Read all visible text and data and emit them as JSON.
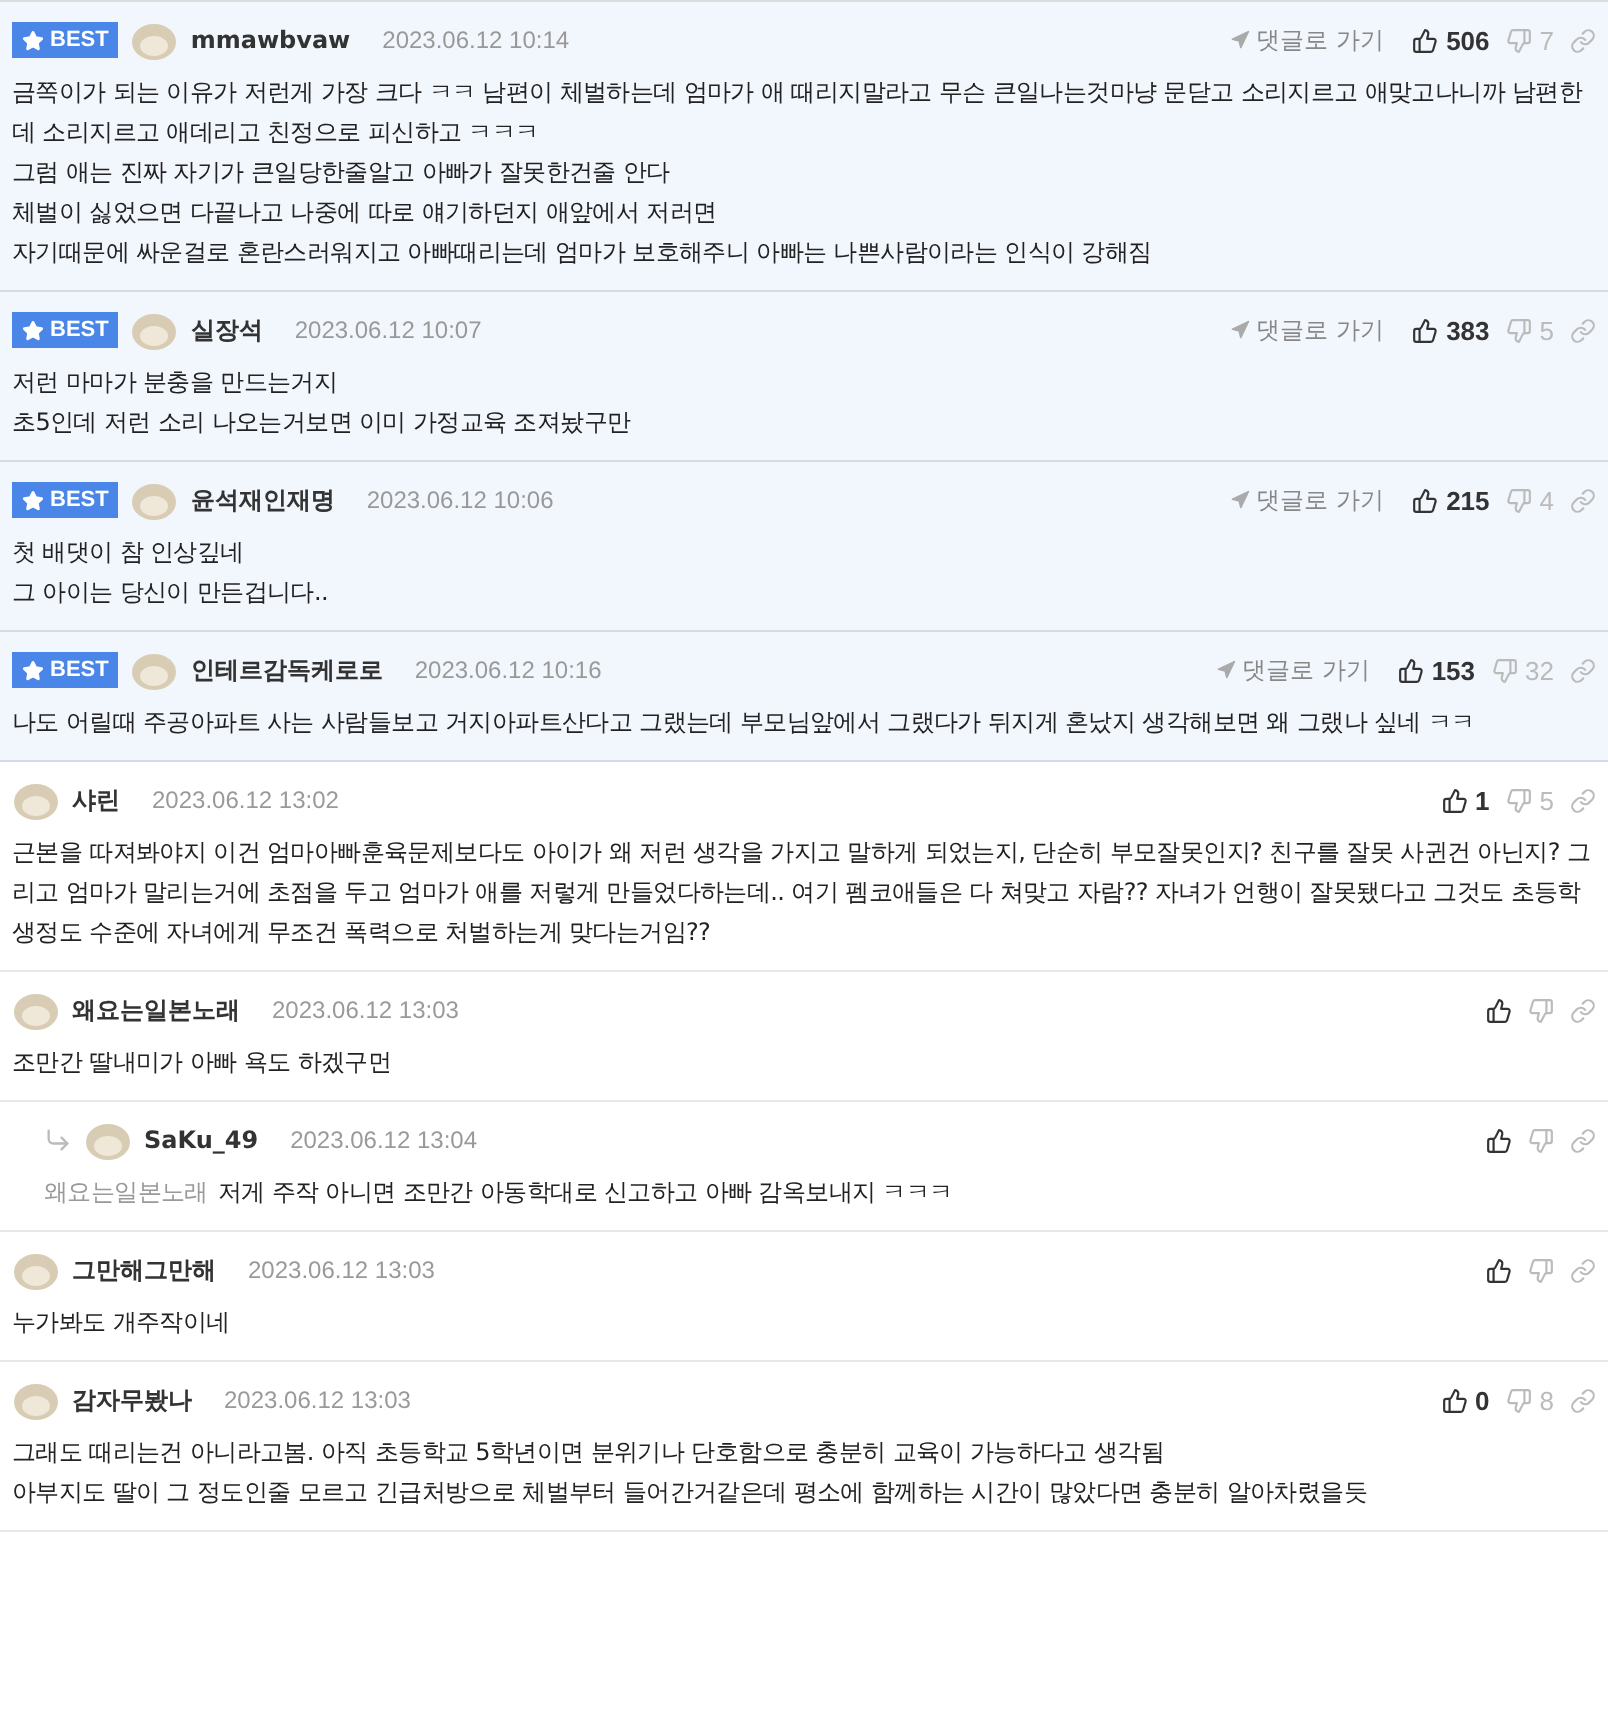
{
  "comments": [
    {
      "best": true,
      "badge": "BEST",
      "author": "mmawbvaw",
      "date": "2023.06.12 10:14",
      "goto": "댓글로 가기",
      "likes": "506",
      "dislikes": "7",
      "lines": [
        "금쪽이가 되는 이유가 저런게 가장 크다 ㅋㅋ 남편이 체벌하는데 엄마가 애 때리지말라고 무슨 큰일나는것마냥 문닫고 소리지르고 애맞고나니까 남편한데 소리지르고 애데리고 친정으로 피신하고 ㅋㅋㅋ",
        "그럼 애는 진짜 자기가 큰일당한줄알고 아빠가 잘못한건줄 안다",
        "체벌이 싫었으면 다끝나고 나중에 따로 얘기하던지 애앞에서 저러면",
        "자기때문에 싸운걸로 혼란스러워지고 아빠때리는데 엄마가 보호해주니 아빠는 나쁜사람이라는 인식이 강해짐"
      ]
    },
    {
      "best": true,
      "badge": "BEST",
      "author": "실장석",
      "date": "2023.06.12 10:07",
      "goto": "댓글로 가기",
      "likes": "383",
      "dislikes": "5",
      "lines": [
        "저런 마마가 분충을 만드는거지",
        "초5인데 저런 소리 나오는거보면 이미 가정교육 조져놨구만"
      ]
    },
    {
      "best": true,
      "badge": "BEST",
      "author": "윤석재인재명",
      "date": "2023.06.12 10:06",
      "goto": "댓글로 가기",
      "likes": "215",
      "dislikes": "4",
      "lines": [
        "첫 배댓이 참 인상깊네",
        "그 아이는 당신이 만든겁니다.."
      ]
    },
    {
      "best": true,
      "badge": "BEST",
      "author": "인테르감독케로로",
      "date": "2023.06.12 10:16",
      "goto": "댓글로 가기",
      "likes": "153",
      "dislikes": "32",
      "lines": [
        "나도 어릴때 주공아파트 사는 사람들보고 거지아파트산다고 그랬는데 부모님앞에서 그랬다가 뒤지게 혼났지 생각해보면 왜 그랬나 싶네 ㅋㅋ"
      ]
    },
    {
      "best": false,
      "author": "샤린",
      "date": "2023.06.12 13:02",
      "likes": "1",
      "dislikes": "5",
      "lines": [
        "근본을 따져봐야지 이건 엄마아빠훈육문제보다도 아이가 왜 저런 생각을 가지고 말하게 되었는지, 단순히 부모잘못인지? 친구를 잘못 사귄건 아닌지? 그리고 엄마가 말리는거에 초점을 두고 엄마가 애를 저렇게 만들었다하는데.. 여기 펨코애들은 다 쳐맞고 자람?? 자녀가 언행이 잘못됐다고 그것도 초등학생정도 수준에 자녀에게 무조건 폭력으로 처벌하는게 맞다는거임??"
      ]
    },
    {
      "best": false,
      "author": "왜요는일본노래",
      "date": "2023.06.12 13:03",
      "lines": [
        "조만간 딸내미가 아빠 욕도 하겠구먼"
      ]
    },
    {
      "best": false,
      "reply": true,
      "author": "SaKu_49",
      "date": "2023.06.12 13:04",
      "mention": "왜요는일본노래",
      "lines": [
        "저게 주작 아니면 조만간 아동학대로 신고하고 아빠 감옥보내지 ㅋㅋㅋ"
      ]
    },
    {
      "best": false,
      "author": "그만해그만해",
      "date": "2023.06.12 13:03",
      "lines": [
        "누가봐도 개주작이네"
      ]
    },
    {
      "best": false,
      "author": "감자무봤나",
      "date": "2023.06.12 13:03",
      "likes": "0",
      "dislikes": "8",
      "lines": [
        "그래도 때리는건 아니라고봄. 아직 초등학교 5학년이면 분위기나 단호함으로 충분히 교육이 가능하다고 생각됨",
        "아부지도 딸이 그 정도인줄 모르고 긴급처방으로 체벌부터 들어간거같은데 평소에 함께하는 시간이 많았다면 충분히 알아차렸을듯"
      ]
    }
  ]
}
